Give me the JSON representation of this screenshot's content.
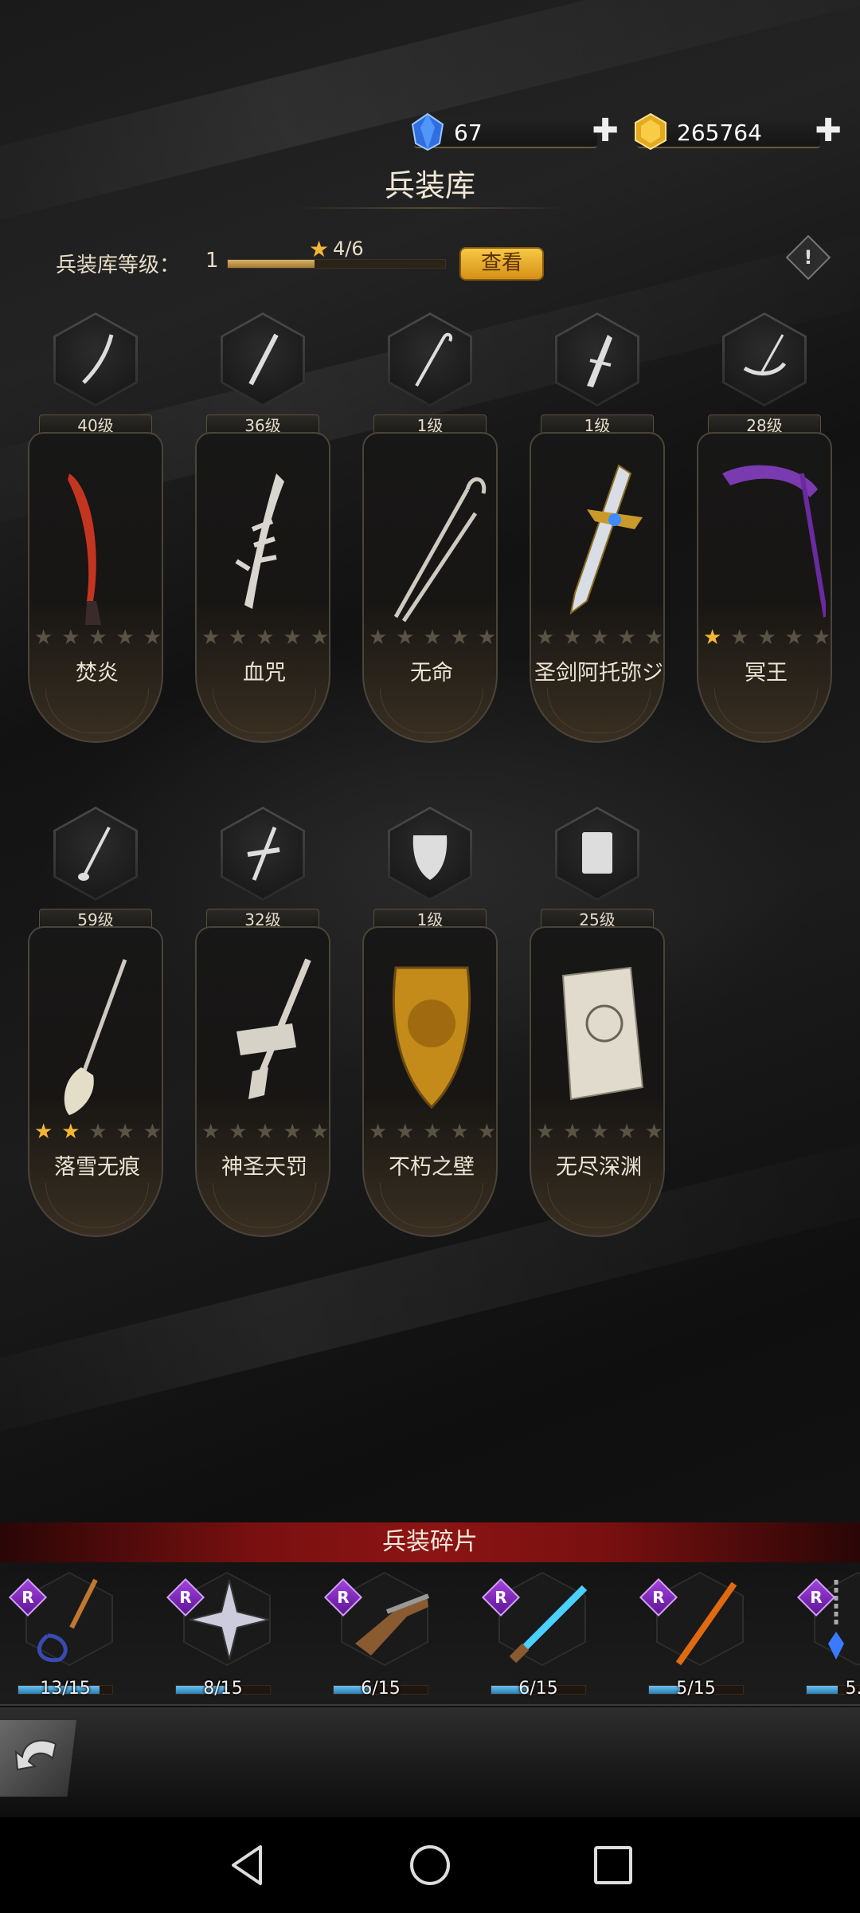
{
  "currency": {
    "gems": "67",
    "gold": "265764",
    "gem_icon": "blue-crystal-icon",
    "gold_icon": "gold-crystal-icon",
    "plus_glyph": "✚"
  },
  "header": {
    "title": "兵装库"
  },
  "armory_level": {
    "label": "兵装库等级：",
    "level": "1",
    "progress_text": "4/6",
    "progress": 0.4,
    "view_button": "查看",
    "info_glyph": "!"
  },
  "weapons": [
    {
      "level": "40级",
      "name": "焚炎",
      "stars": 0,
      "icon": "curved-dagger-icon"
    },
    {
      "level": "36级",
      "name": "血咒",
      "stars": 0,
      "icon": "serrated-blade-icon"
    },
    {
      "level": "1级",
      "name": "无命",
      "stars": 0,
      "icon": "cane-icon"
    },
    {
      "level": "1级",
      "name": "圣剑阿托弥ジ",
      "stars": 0,
      "icon": "holy-sword-icon"
    },
    {
      "level": "28级",
      "name": "冥王",
      "stars": 1,
      "icon": "scythe-icon"
    },
    {
      "level": "59级",
      "name": "落雪无痕",
      "stars": 2,
      "icon": "broom-spear-icon"
    },
    {
      "level": "32级",
      "name": "神圣天罚",
      "stars": 0,
      "icon": "cross-hammer-icon"
    },
    {
      "level": "1级",
      "name": "不朽之壁",
      "stars": 0,
      "icon": "lion-shield-icon"
    },
    {
      "level": "25级",
      "name": "无尽深渊",
      "stars": 0,
      "icon": "tome-icon"
    }
  ],
  "fragments": {
    "title": "兵装碎片",
    "rarity_label": "R",
    "items": [
      {
        "count": "13/15",
        "progress": 0.867,
        "icon": "flail-icon"
      },
      {
        "count": "8/15",
        "progress": 0.533,
        "icon": "shuriken-icon"
      },
      {
        "count": "6/15",
        "progress": 0.4,
        "icon": "flintlock-pistol-icon"
      },
      {
        "count": "6/15",
        "progress": 0.4,
        "icon": "blue-rifle-icon"
      },
      {
        "count": "5/15",
        "progress": 0.333,
        "icon": "orange-staff-icon"
      },
      {
        "count": "5.",
        "progress": 0.333,
        "icon": "chain-gem-icon"
      }
    ]
  },
  "nav": {
    "back": "back-triangle-icon",
    "home": "home-circle-icon",
    "recents": "recents-square-icon"
  }
}
